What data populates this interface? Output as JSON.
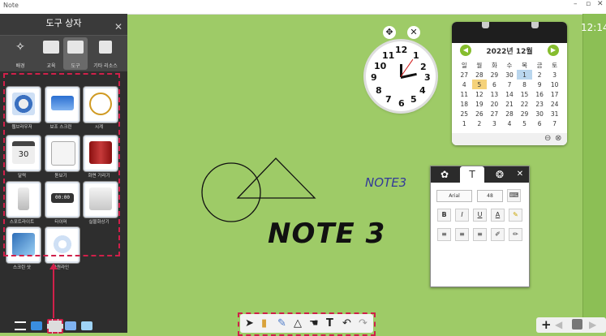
{
  "app": {
    "title": "Note",
    "time": "12:14"
  },
  "toolbox": {
    "header": "도구 상자",
    "tabs": [
      {
        "label": "배경"
      },
      {
        "label": "교육"
      },
      {
        "label": "도구"
      },
      {
        "label": "기타 리소스"
      }
    ],
    "tiles": [
      {
        "label": "웹브라우저",
        "icon": "web-browser-icon"
      },
      {
        "label": "보조 스크린",
        "icon": "screen-icon"
      },
      {
        "label": "시계",
        "icon": "clock-icon"
      },
      {
        "label": "달력",
        "icon": "calendar-icon"
      },
      {
        "label": "돋보기",
        "icon": "magnifier-icon"
      },
      {
        "label": "화면 가리기",
        "icon": "curtain-icon"
      },
      {
        "label": "스포트라이트",
        "icon": "spotlight-icon"
      },
      {
        "label": "타이머",
        "icon": "timer-icon"
      },
      {
        "label": "실물화상기",
        "icon": "document-camera-icon"
      },
      {
        "label": "스크린 샷",
        "icon": "screenshot-icon"
      },
      {
        "label": "타원라인",
        "icon": "ellipse-line-icon"
      }
    ],
    "calendar_tile_number": "30",
    "timer_digits": "00:00"
  },
  "calendar": {
    "month": "2022년 12월",
    "weekdays": [
      "일",
      "월",
      "화",
      "수",
      "목",
      "금",
      "토"
    ],
    "weeks": [
      [
        "27",
        "28",
        "29",
        "30",
        "1",
        "2",
        "3"
      ],
      [
        "4",
        "5",
        "6",
        "7",
        "8",
        "9",
        "10"
      ],
      [
        "11",
        "12",
        "13",
        "14",
        "15",
        "16",
        "17"
      ],
      [
        "18",
        "19",
        "20",
        "21",
        "22",
        "23",
        "24"
      ],
      [
        "25",
        "26",
        "27",
        "28",
        "29",
        "30",
        "31"
      ],
      [
        "1",
        "2",
        "3",
        "4",
        "5",
        "6",
        "7"
      ]
    ],
    "today": "1",
    "highlight": "5"
  },
  "clock": {
    "numbers": [
      "12",
      "1",
      "2",
      "3",
      "4",
      "5",
      "6",
      "7",
      "8",
      "9",
      "10",
      "11"
    ]
  },
  "text_panel": {
    "font": "Arial",
    "size": "48",
    "buttons": [
      "B",
      "I",
      "U",
      "A"
    ]
  },
  "canvas": {
    "note_small": "NOTE3",
    "note_big": "NOTE 3"
  },
  "colors": {
    "background": "#9ecb67",
    "accent": "#d0204a",
    "calendar_green": "#86bd2e"
  }
}
